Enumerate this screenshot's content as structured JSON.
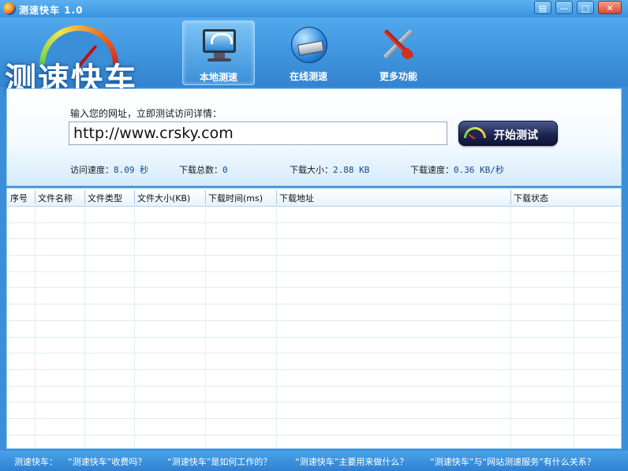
{
  "window": {
    "title": "测速快车 1.0",
    "buttons": [
      "▤",
      "—",
      "□",
      "✕"
    ]
  },
  "logo": {
    "text": "测速快车"
  },
  "toolbar": [
    {
      "label": "本地测速",
      "icon": "monitor-icon",
      "active": true
    },
    {
      "label": "在线测速",
      "icon": "globe-icon",
      "active": false
    },
    {
      "label": "更多功能",
      "icon": "tools-icon",
      "active": false
    }
  ],
  "main": {
    "prompt": "输入您的网址，立即测试访问详情：",
    "url_value": "http://www.crsky.com",
    "start_button": "开始测试",
    "stats": [
      {
        "label": "访问速度：",
        "value": "8.09 秒"
      },
      {
        "label": "下载总数：",
        "value": "0"
      },
      {
        "label": "下载大小：",
        "value": "2.88 KB"
      },
      {
        "label": "下载速度：",
        "value": "0.36 KB/秒"
      }
    ]
  },
  "table": {
    "columns": [
      "序号",
      "文件名称",
      "文件类型",
      "文件大小(KB)",
      "下载时间(ms)",
      "下载地址",
      "下载状态"
    ],
    "rows": []
  },
  "footer": {
    "links": [
      "测速快车：",
      "“测速快车”收费吗？",
      "“测速快车”是如何工作的？",
      "“测速快车”主要用来做什么？",
      "“测速快车”与“网站测速服务”有什么关系？"
    ]
  },
  "colors": {
    "accent": "#3b8fd8",
    "button_dark": "#1d2651",
    "value_text": "#19468c"
  }
}
